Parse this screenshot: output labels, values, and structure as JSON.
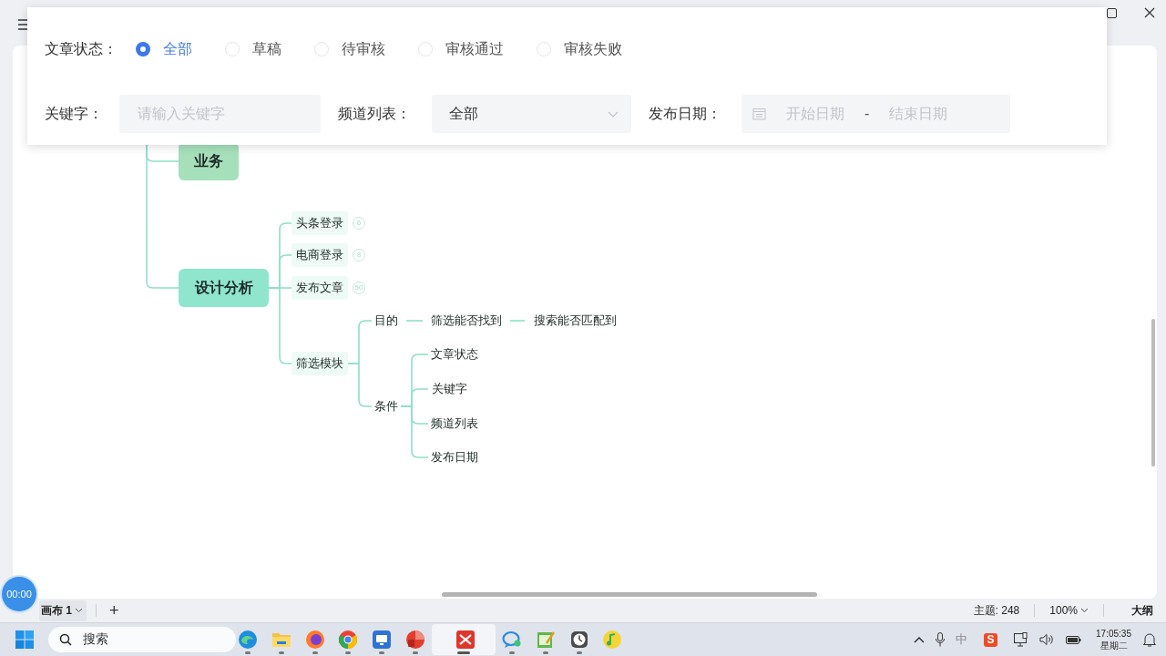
{
  "filter_panel": {
    "status_label": "文章状态：",
    "status_options": [
      {
        "label": "全部",
        "selected": true
      },
      {
        "label": "草稿",
        "selected": false
      },
      {
        "label": "待审核",
        "selected": false
      },
      {
        "label": "审核通过",
        "selected": false
      },
      {
        "label": "审核失败",
        "selected": false
      }
    ],
    "keyword": {
      "label": "关键字：",
      "placeholder": "请输入关键字"
    },
    "channel": {
      "label": "频道列表：",
      "value": "全部"
    },
    "date": {
      "label": "发布日期：",
      "start_placeholder": "开始日期",
      "separator": "-",
      "end_placeholder": "结束日期"
    }
  },
  "mindmap": {
    "topics": [
      {
        "text": "业务",
        "color": "#a5e0bb"
      },
      {
        "text": "设计分析",
        "color": "#8fe6cd",
        "children": [
          {
            "text": "头条登录",
            "badge": "6"
          },
          {
            "text": "电商登录",
            "badge": "8"
          },
          {
            "text": "发布文章",
            "badge": "50"
          },
          {
            "text": "筛选模块",
            "children": [
              {
                "text": "目的",
                "children": [
                  {
                    "text": "筛选能否找到",
                    "children": [
                      {
                        "text": "搜索能否匹配到"
                      }
                    ]
                  }
                ]
              },
              {
                "text": "条件",
                "children": [
                  {
                    "text": "文章状态"
                  },
                  {
                    "text": "关键字"
                  },
                  {
                    "text": "频道列表"
                  },
                  {
                    "text": "发布日期"
                  }
                ]
              }
            ]
          }
        ]
      }
    ]
  },
  "timer": "00:00",
  "canvas_tabs": [
    {
      "label": "画布 1",
      "selected": true
    }
  ],
  "add_tab": "+",
  "status": {
    "topics": "主题: 248",
    "zoom": "100%",
    "outline": "大纲"
  },
  "taskbar": {
    "search_placeholder": "搜索",
    "apps": [
      {
        "kind": "edge",
        "running": true,
        "selected": false
      },
      {
        "kind": "folder",
        "running": true,
        "selected": false
      },
      {
        "kind": "firefox",
        "running": true,
        "selected": false
      },
      {
        "kind": "chrome",
        "running": true,
        "selected": false
      },
      {
        "kind": "remote",
        "running": true,
        "selected": false
      },
      {
        "kind": "pdf",
        "running": true,
        "selected": false
      },
      {
        "kind": "xmind",
        "running": true,
        "selected": true
      },
      {
        "kind": "chat",
        "running": true,
        "selected": false
      },
      {
        "kind": "notepad",
        "running": true,
        "selected": false
      },
      {
        "kind": "clock",
        "running": true,
        "selected": false
      },
      {
        "kind": "music",
        "running": false,
        "selected": false
      }
    ],
    "ime": "中",
    "sogou": "S",
    "time": "17:05:35",
    "day": "星期二"
  }
}
